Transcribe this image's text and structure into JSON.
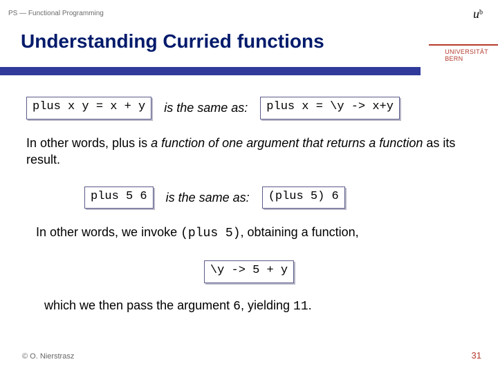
{
  "header": {
    "course": "PS — Functional Programming",
    "title": "Understanding Curried functions",
    "uni_line1": "UNIVERSITÄT",
    "uni_line2": "BERN",
    "logo_u": "u",
    "logo_b": "b"
  },
  "row1": {
    "code_left": "plus x y = x + y",
    "link": "is the same as:",
    "code_right": "plus x = \\y -> x+y"
  },
  "para1": {
    "pre": "In other words, plus is ",
    "ital1": "a function of one argument that returns a function",
    "post": " as its result."
  },
  "row2": {
    "code_left": "plus 5 6",
    "link": "is the same as:",
    "code_right": "(plus 5) 6"
  },
  "para2": {
    "pre": "In other words, we invoke ",
    "mono1": "(plus 5)",
    "post": ", obtaining a function,"
  },
  "box3": {
    "code": "\\y -> 5 + y"
  },
  "para3": {
    "pre": "which we then pass the argument ",
    "mono1": "6",
    "mid": ", yielding ",
    "mono2": "11",
    "post": "."
  },
  "footer": {
    "copyright": "© O. Nierstrasz",
    "page": "31"
  }
}
